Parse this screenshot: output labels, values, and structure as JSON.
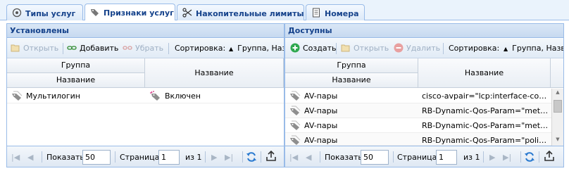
{
  "tabs": [
    {
      "label": "Типы услуг",
      "icon": "gear-icon"
    },
    {
      "label": "Признаки услуг",
      "icon": "tags-icon"
    },
    {
      "label": "Накопительные лимиты",
      "icon": "scissors-icon"
    },
    {
      "label": "Номера",
      "icon": "document-icon"
    }
  ],
  "left": {
    "title": "Установлены",
    "toolbar": {
      "open": "Открыть",
      "add": "Добавить",
      "remove": "Убрать",
      "sort_label": "Сортировка:",
      "sort_value": "Группа, Название"
    },
    "columns": {
      "group": "Группа",
      "name_sub": "Название",
      "name": "Название"
    },
    "rows": [
      {
        "group": "Мультилогин",
        "name": "Включен"
      }
    ],
    "pager": {
      "show_label": "Показать",
      "page_size": "50",
      "page_label": "Страница",
      "page": "1",
      "of": "из 1"
    }
  },
  "right": {
    "title": "Доступны",
    "toolbar": {
      "create": "Создать",
      "open": "Открыть",
      "delete": "Удалить",
      "sort_label": "Сортировка:",
      "sort_value": "Группа, Название"
    },
    "columns": {
      "group": "Группа",
      "name_sub": "Название",
      "name": "Название"
    },
    "rows": [
      {
        "group": "AV-пары",
        "name": "cisco-avpair=\"lcp:interface-config..."
      },
      {
        "group": "AV-пары",
        "name": "RB-Dynamic-Qos-Param=\"meter-c..."
      },
      {
        "group": "AV-пары",
        "name": "RB-Dynamic-Qos-Param=\"meter-c..."
      },
      {
        "group": "AV-пары",
        "name": "RB-Dynamic-Qos-Param=\"police-c..."
      }
    ],
    "pager": {
      "show_label": "Показать",
      "page_size": "50",
      "page_label": "Страница",
      "page": "1",
      "of": "из 1"
    }
  }
}
